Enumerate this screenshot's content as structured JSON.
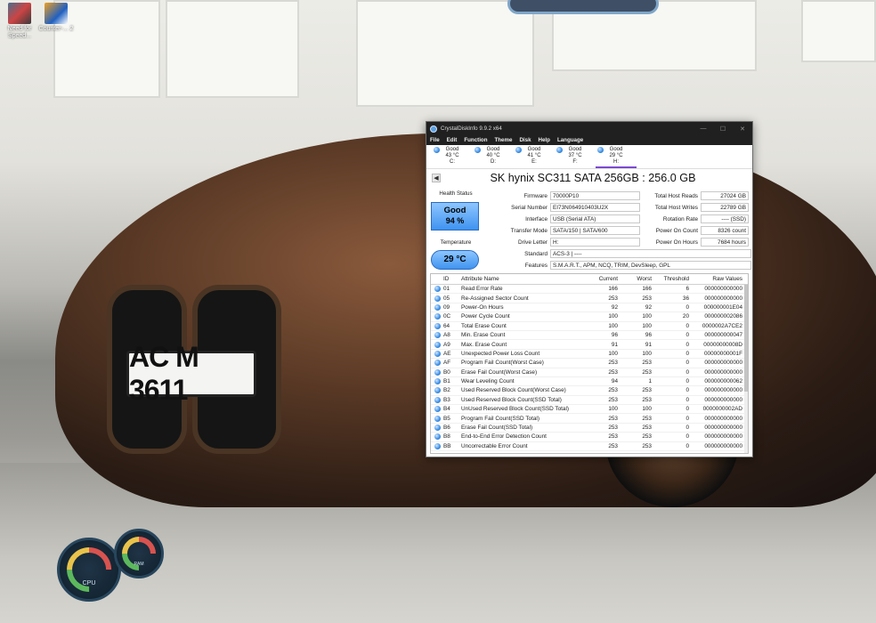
{
  "desktop": {
    "icons": [
      {
        "label": "Need for Speed..."
      },
      {
        "label": "Counter-... 2"
      }
    ],
    "plate_text": "AC M 3611",
    "gauges": [
      {
        "label": "CPU"
      },
      {
        "label": "RAM"
      }
    ]
  },
  "window": {
    "title": "CrystalDiskInfo 9.9.2 x64",
    "controls": {
      "minimize": "—",
      "maximize": "☐",
      "close": "✕"
    },
    "menu": [
      "File",
      "Edit",
      "Function",
      "Theme",
      "Disk",
      "Help",
      "Language"
    ],
    "drives": [
      {
        "status": "Good",
        "temp": "43 °C",
        "letter": "C:"
      },
      {
        "status": "Good",
        "temp": "40 °C",
        "letter": "D:"
      },
      {
        "status": "Good",
        "temp": "41 °C",
        "letter": "E:"
      },
      {
        "status": "Good",
        "temp": "37 °C",
        "letter": "F:"
      },
      {
        "status": "Good",
        "temp": "29 °C",
        "letter": "H:"
      }
    ],
    "nav_prev": "◀",
    "model": "SK hynix SC311 SATA 256GB : 256.0 GB",
    "health": {
      "label": "Health Status",
      "status": "Good",
      "percent": "94 %"
    },
    "temperature": {
      "label": "Temperature",
      "value": "29 °C"
    },
    "fields": {
      "firmware": {
        "label": "Firmware",
        "value": "70000P10"
      },
      "serial": {
        "label": "Serial Number",
        "value": "EI73N064910403U2X"
      },
      "interface": {
        "label": "Interface",
        "value": "USB (Serial ATA)"
      },
      "transfer": {
        "label": "Transfer Mode",
        "value": "SATA/150 | SATA/600"
      },
      "drive_letter": {
        "label": "Drive Letter",
        "value": "H:"
      },
      "standard": {
        "label": "Standard",
        "value": "ACS-3 | ----"
      },
      "features": {
        "label": "Features",
        "value": "S.M.A.R.T., APM, NCQ, TRIM, DevSleep, GPL"
      }
    },
    "right_fields": [
      {
        "label": "Total Host Reads",
        "value": "27024 GB"
      },
      {
        "label": "Total Host Writes",
        "value": "22789 GB"
      },
      {
        "label": "Rotation Rate",
        "value": "---- (SSD)"
      },
      {
        "label": "Power On Count",
        "value": "8326 count"
      },
      {
        "label": "Power On Hours",
        "value": "7684 hours"
      }
    ],
    "table": {
      "headers": [
        "ID",
        "Attribute Name",
        "Current",
        "Worst",
        "Threshold",
        "Raw Values"
      ],
      "rows": [
        {
          "id": "01",
          "name": "Read Error Rate",
          "cur": "166",
          "worst": "166",
          "thr": "6",
          "raw": "000000000000"
        },
        {
          "id": "05",
          "name": "Re-Assigned Sector Count",
          "cur": "253",
          "worst": "253",
          "thr": "36",
          "raw": "000000000000"
        },
        {
          "id": "09",
          "name": "Power-On Hours",
          "cur": "92",
          "worst": "92",
          "thr": "0",
          "raw": "000000001E04"
        },
        {
          "id": "0C",
          "name": "Power Cycle Count",
          "cur": "100",
          "worst": "100",
          "thr": "20",
          "raw": "000000002086"
        },
        {
          "id": "64",
          "name": "Total Erase Count",
          "cur": "100",
          "worst": "100",
          "thr": "0",
          "raw": "0000002A7CE2"
        },
        {
          "id": "A8",
          "name": "Min. Erase Count",
          "cur": "96",
          "worst": "96",
          "thr": "0",
          "raw": "000000000047"
        },
        {
          "id": "A9",
          "name": "Max. Erase Count",
          "cur": "91",
          "worst": "91",
          "thr": "0",
          "raw": "00000000008D"
        },
        {
          "id": "AE",
          "name": "Unexpected Power Loss Count",
          "cur": "100",
          "worst": "100",
          "thr": "0",
          "raw": "00000000001F"
        },
        {
          "id": "AF",
          "name": "Program Fail Count(Worst Case)",
          "cur": "253",
          "worst": "253",
          "thr": "0",
          "raw": "000000000000"
        },
        {
          "id": "B0",
          "name": "Erase Fail Count(Worst Case)",
          "cur": "253",
          "worst": "253",
          "thr": "0",
          "raw": "000000000000"
        },
        {
          "id": "B1",
          "name": "Wear Leveling Count",
          "cur": "94",
          "worst": "1",
          "thr": "0",
          "raw": "000000000062"
        },
        {
          "id": "B2",
          "name": "Used Reserved Block Count(Worst Case)",
          "cur": "253",
          "worst": "253",
          "thr": "0",
          "raw": "000000000000"
        },
        {
          "id": "B3",
          "name": "Used Reserved Block Count(SSD Total)",
          "cur": "253",
          "worst": "253",
          "thr": "0",
          "raw": "000000000000"
        },
        {
          "id": "B4",
          "name": "UnUsed Reserved Block Count(SSD Total)",
          "cur": "100",
          "worst": "100",
          "thr": "0",
          "raw": "0000000002AD"
        },
        {
          "id": "B5",
          "name": "Program Fail Count(SSD Total)",
          "cur": "253",
          "worst": "253",
          "thr": "0",
          "raw": "000000000000"
        },
        {
          "id": "B6",
          "name": "Erase Fail Count(SSD Total)",
          "cur": "253",
          "worst": "253",
          "thr": "0",
          "raw": "000000000000"
        },
        {
          "id": "B8",
          "name": "End-to-End Error Detection Count",
          "cur": "253",
          "worst": "253",
          "thr": "0",
          "raw": "000000000000"
        },
        {
          "id": "BB",
          "name": "Uncorrectable Error Count",
          "cur": "253",
          "worst": "253",
          "thr": "0",
          "raw": "000000000000"
        }
      ]
    }
  }
}
